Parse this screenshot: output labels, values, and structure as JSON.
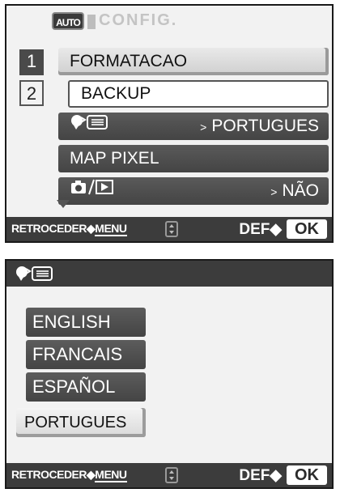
{
  "screen1": {
    "mode_badge": "AUTO",
    "title": "CONFIG.",
    "tabs": [
      "1",
      "2"
    ],
    "rows": [
      {
        "label": "FORMATACAO"
      },
      {
        "label": "BACKUP"
      },
      {
        "icon": "language-icon",
        "value": "PORTUGUES"
      },
      {
        "label": "MAP PIXEL"
      },
      {
        "icon": "camera-playback-icon",
        "value": "NÃO"
      }
    ],
    "footer": {
      "back": "RETROCEDER",
      "menu": "MENU",
      "def": "DEF",
      "ok": "OK"
    }
  },
  "screen2": {
    "header_icon": "language-icon",
    "languages": [
      "ENGLISH",
      "FRANCAIS",
      "ESPAÑOL",
      "PORTUGUES"
    ],
    "selected": "PORTUGUES",
    "footer": {
      "back": "RETROCEDER",
      "menu": "MENU",
      "def": "DEF",
      "ok": "OK"
    }
  }
}
